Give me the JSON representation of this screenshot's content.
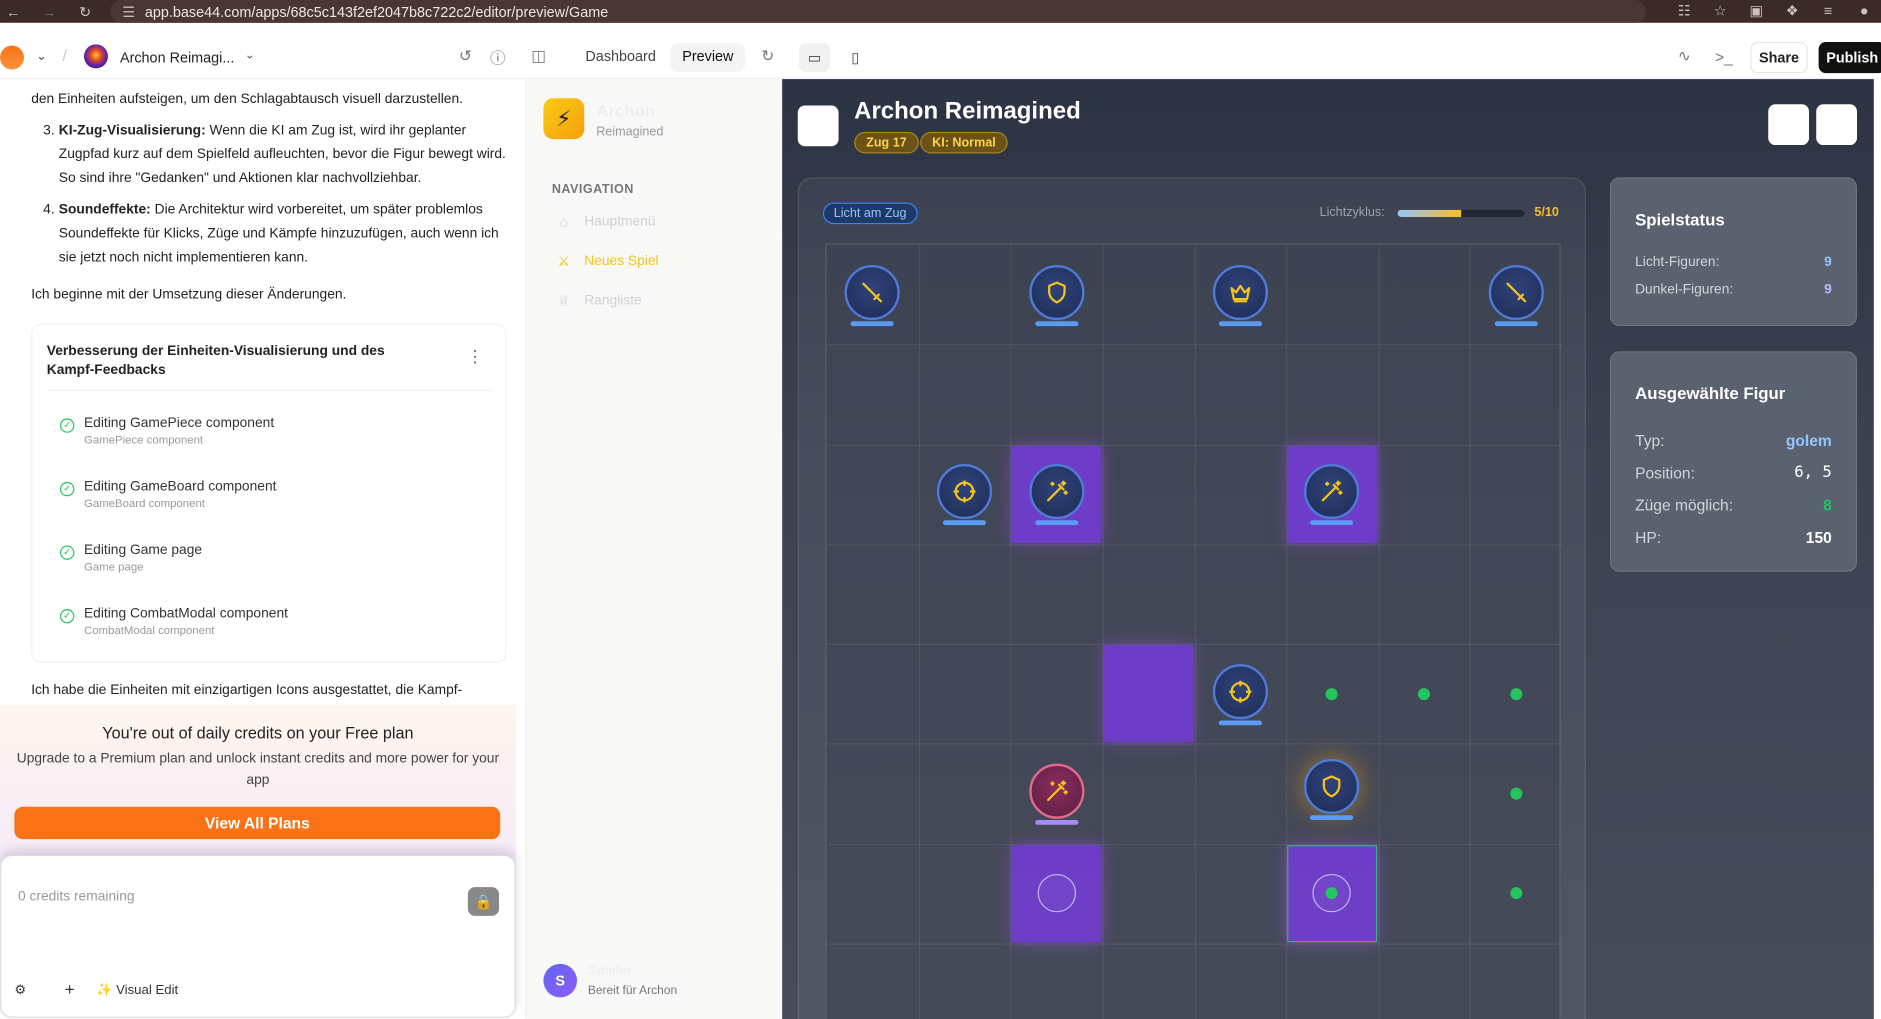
{
  "browser": {
    "url": "app.base44.com/apps/68c5c143f2ef2047b8c722c2/editor/preview/Game"
  },
  "toolbar": {
    "project_name": "Archon Reimagi...",
    "tabs": [
      {
        "label": "Dashboard",
        "active": false
      },
      {
        "label": "Preview",
        "active": true
      }
    ],
    "share_label": "Share",
    "publish_label": "Publish"
  },
  "chat": {
    "intro_line": "den Einheiten aufsteigen, um den Schlagabtausch visuell darzustellen.",
    "items": [
      {
        "num": "3.",
        "title": "KI-Zug-Visualisierung:",
        "text": "Wenn die KI am Zug ist, wird ihr geplanter Zugpfad kurz auf dem Spielfeld aufleuchten, bevor die Figur bewegt wird. So sind ihre \"Gedanken\" und Aktionen klar nachvollziehbar."
      },
      {
        "num": "4.",
        "title": "Soundeffekte:",
        "text": "Die Architektur wird vorbereitet, um später problemlos Soundeffekte für Klicks, Züge und Kämpfe hinzuzufügen, auch wenn ich sie jetzt noch nicht implementieren kann."
      }
    ],
    "start_line": "Ich beginne mit der Umsetzung dieser Änderungen.",
    "card_title": "Verbesserung der Einheiten-Visualisierung und des Kampf-Feedbacks",
    "steps": [
      {
        "label": "Editing GamePiece component",
        "sub": "GamePiece component"
      },
      {
        "label": "Editing GameBoard component",
        "sub": "GameBoard component"
      },
      {
        "label": "Editing Game page",
        "sub": "Game page"
      },
      {
        "label": "Editing CombatModal component",
        "sub": "CombatModal component"
      }
    ],
    "trailing_text": "Ich habe die Einheiten mit einzigartigen Icons ausgestattet, die Kampf-",
    "credits_heading": "You're out of daily credits on your Free plan",
    "credits_text": "Upgrade to a Premium plan and unlock instant credits and more power for your app",
    "view_plans_label": "View All Plans",
    "input_placeholder": "0 credits remaining",
    "visual_edit_label": "Visual Edit"
  },
  "sidebar": {
    "app_name": "Archon",
    "app_sub": "Reimagined",
    "nav_heading": "NAVIGATION",
    "items": [
      {
        "label": "Hauptmenü",
        "icon": "home-icon",
        "active": false
      },
      {
        "label": "Neues Spiel",
        "icon": "swords-icon",
        "active": true
      },
      {
        "label": "Rangliste",
        "icon": "trophy-icon",
        "active": false
      }
    ],
    "user_initial": "S",
    "user_name": "Spieler",
    "user_status": "Bereit für Archon"
  },
  "game": {
    "title": "Archon Reimagined",
    "badges": [
      "Zug 17",
      "KI: Normal"
    ],
    "turn_label": "Licht am Zug",
    "cycle_label": "Lichtzyklus:",
    "cycle_value": "5/10",
    "cycle_fraction": 0.5,
    "status": {
      "title": "Spielstatus",
      "rows": [
        {
          "label": "Licht-Figuren:",
          "value": "9",
          "color": "#93c5fd"
        },
        {
          "label": "Dunkel-Figuren:",
          "value": "9",
          "color": "#c4b5fd"
        }
      ]
    },
    "selected": {
      "title": "Ausgewählte Figur",
      "rows": [
        {
          "label": "Typ:",
          "value": "golem",
          "color": "#93c5fd"
        },
        {
          "label": "Position:",
          "value": "6, 5",
          "color": "#ffffff"
        },
        {
          "label": "Züge möglich:",
          "value": "8",
          "color": "#22c55e"
        },
        {
          "label": "HP:",
          "value": "150",
          "color": "#ffffff"
        }
      ]
    },
    "board": {
      "cols": 8,
      "rows": 8,
      "highlights": [
        [
          2,
          2
        ],
        [
          2,
          5
        ],
        [
          4,
          3
        ],
        [
          6,
          2
        ]
      ],
      "selected_cell": [
        6,
        5
      ],
      "pieces": [
        {
          "r": 0,
          "c": 0,
          "icon": "sword-icon",
          "side": "light"
        },
        {
          "r": 0,
          "c": 2,
          "icon": "shield-icon",
          "side": "light"
        },
        {
          "r": 0,
          "c": 4,
          "icon": "crown-icon",
          "side": "light"
        },
        {
          "r": 0,
          "c": 7,
          "icon": "sword-icon",
          "side": "light"
        },
        {
          "r": 2,
          "c": 1,
          "icon": "crosshair-icon",
          "side": "light"
        },
        {
          "r": 2,
          "c": 2,
          "icon": "wand-icon",
          "side": "light"
        },
        {
          "r": 2,
          "c": 5,
          "icon": "wand-icon",
          "side": "light"
        },
        {
          "r": 4,
          "c": 4,
          "icon": "crosshair-icon",
          "side": "light"
        },
        {
          "r": 5,
          "c": 2,
          "icon": "wand-icon",
          "side": "dark"
        },
        {
          "r": 5,
          "c": 5,
          "icon": "shield-icon",
          "side": "light"
        }
      ],
      "moves": [
        [
          4,
          5
        ],
        [
          4,
          6
        ],
        [
          4,
          7
        ],
        [
          5,
          5
        ],
        [
          5,
          7
        ],
        [
          6,
          5
        ],
        [
          6,
          7
        ]
      ],
      "rings": [
        [
          6,
          2
        ],
        [
          6,
          5
        ]
      ]
    }
  }
}
